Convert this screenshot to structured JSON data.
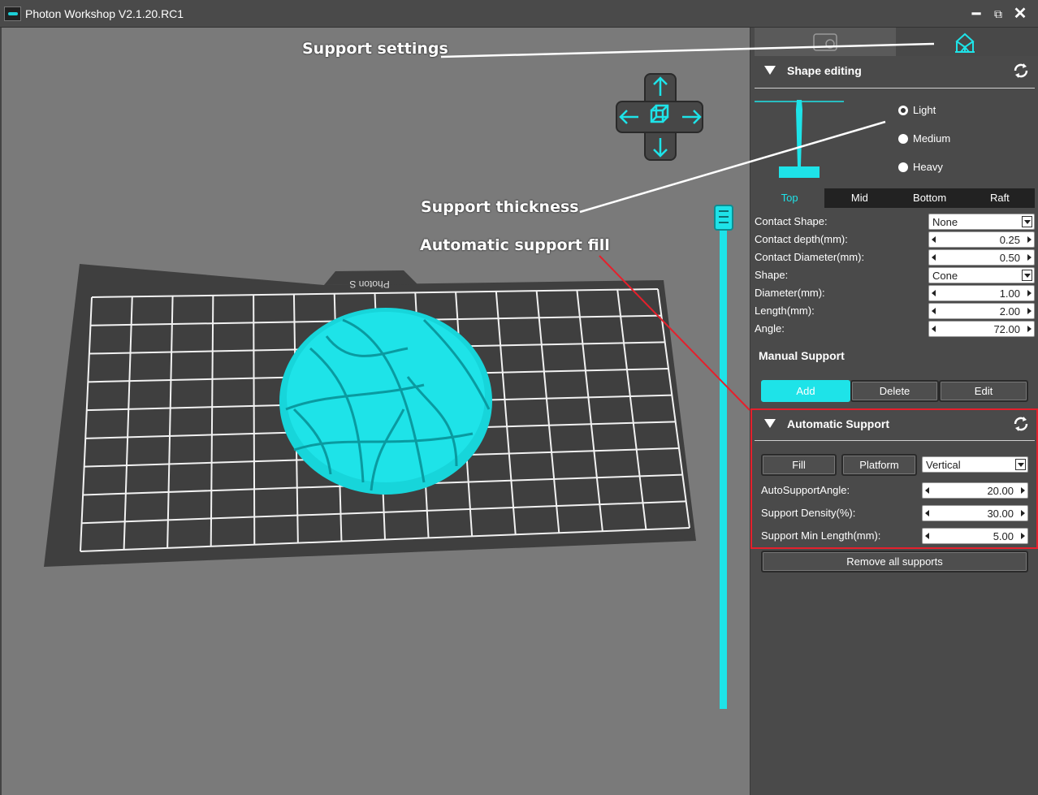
{
  "window": {
    "title": "Photon Workshop V2.1.20.RC1",
    "minimize": "━",
    "restore": "⧉",
    "close": "✕"
  },
  "viewport": {
    "plate_label": "Photon S",
    "colors": {
      "model": "#1ee3e8",
      "plate": "#3f3f3f",
      "background": "#7a7a7a"
    }
  },
  "annotations": {
    "support_settings": "Support settings",
    "support_thickness": "Support thickness",
    "automatic_support_fill": "Automatic support fill"
  },
  "panel": {
    "shape_editing": {
      "title": "Shape editing",
      "thickness_options": [
        {
          "label": "Light",
          "selected": true
        },
        {
          "label": "Medium",
          "selected": false
        },
        {
          "label": "Heavy",
          "selected": false
        }
      ],
      "tabs": [
        {
          "label": "Top",
          "active": true
        },
        {
          "label": "Mid",
          "active": false
        },
        {
          "label": "Bottom",
          "active": false
        },
        {
          "label": "Raft",
          "active": false
        }
      ],
      "contact_shape": {
        "label": "Contact Shape:",
        "value": "None"
      },
      "contact_depth": {
        "label": "Contact depth(mm):",
        "value": "0.25"
      },
      "contact_diameter": {
        "label": "Contact Diameter(mm):",
        "value": "0.50"
      },
      "shape": {
        "label": "Shape:",
        "value": "Cone"
      },
      "diameter": {
        "label": "Diameter(mm):",
        "value": "1.00"
      },
      "length": {
        "label": "Length(mm):",
        "value": "2.00"
      },
      "angle": {
        "label": "Angle:",
        "value": "72.00"
      }
    },
    "manual_support": {
      "title": "Manual Support",
      "add": "Add",
      "delete": "Delete",
      "edit": "Edit"
    },
    "automatic_support": {
      "title": "Automatic Support",
      "fill": "Fill",
      "platform": "Platform",
      "direction": "Vertical",
      "auto_angle": {
        "label": "AutoSupportAngle:",
        "value": "20.00"
      },
      "density": {
        "label": "Support Density(%):",
        "value": "30.00"
      },
      "min_length": {
        "label": "Support Min Length(mm):",
        "value": "5.00"
      },
      "remove_all": "Remove all supports"
    }
  },
  "colors": {
    "accent": "#1ee3e8",
    "highlight_box": "#e5202c"
  }
}
